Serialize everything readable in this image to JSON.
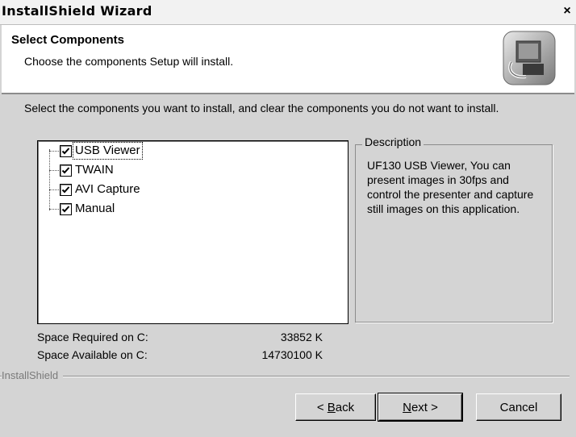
{
  "window": {
    "title": "InstallShield Wizard",
    "close_glyph": "×",
    "close_icon": "close-icon"
  },
  "header": {
    "title": "Select Components",
    "subtitle": "Choose the components Setup will install.",
    "logo_icon": "installer-computer-icon"
  },
  "instructions": "Select the components you want to install, and clear the components you do not want to install.",
  "components": [
    {
      "label": "USB Viewer",
      "checked": true,
      "selected": true
    },
    {
      "label": "TWAIN",
      "checked": true,
      "selected": false
    },
    {
      "label": "AVI Capture",
      "checked": true,
      "selected": false
    },
    {
      "label": "Manual",
      "checked": true,
      "selected": false
    }
  ],
  "description": {
    "legend": "Description",
    "text": "UF130 USB Viewer, You can present images in 30fps and control the presenter and capture still images on this application."
  },
  "space": {
    "required_label": "Space Required on  C:",
    "required_value": "33852 K",
    "available_label": "Space Available on  C:",
    "available_value": "14730100 K"
  },
  "brand": "InstallShield",
  "buttons": {
    "back_prefix": "< ",
    "back_accel": "B",
    "back_rest": "ack",
    "next_accel": "N",
    "next_rest": "ext >",
    "cancel": "Cancel"
  }
}
